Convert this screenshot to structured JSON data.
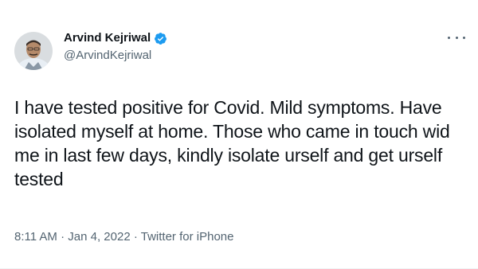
{
  "author": {
    "name": "Arvind Kejriwal",
    "handle": "@ArvindKejriwal",
    "verified": true
  },
  "tweet": {
    "text": "I have tested positive for Covid. Mild symptoms. Have isolated myself at home. Those who came in touch wid me in last few days, kindly isolate urself and get urself tested",
    "time": "8:11 AM",
    "separator": "·",
    "date": "Jan 4, 2022",
    "source": "Twitter for iPhone"
  },
  "icons": {
    "more": "more-options-icon",
    "verified": "verified-badge-icon"
  },
  "colors": {
    "verified_blue": "#1d9bf0",
    "secondary_text": "#536471",
    "primary_text": "#0f1419"
  }
}
